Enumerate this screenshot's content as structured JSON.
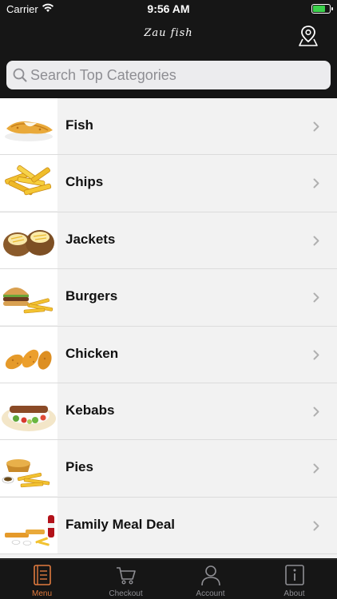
{
  "status_bar": {
    "carrier": "Carrier",
    "time": "9:56 AM"
  },
  "header": {
    "logo_text": "Zau fish"
  },
  "search": {
    "placeholder": "Search Top Categories",
    "value": ""
  },
  "categories": [
    {
      "label": "Fish",
      "icon": "fish-image"
    },
    {
      "label": "Chips",
      "icon": "chips-image"
    },
    {
      "label": "Jackets",
      "icon": "jackets-image"
    },
    {
      "label": "Burgers",
      "icon": "burgers-image"
    },
    {
      "label": "Chicken",
      "icon": "chicken-image"
    },
    {
      "label": "Kebabs",
      "icon": "kebabs-image"
    },
    {
      "label": "Pies",
      "icon": "pies-image"
    },
    {
      "label": "Family Meal Deal",
      "icon": "family-meal-image"
    }
  ],
  "tabs": [
    {
      "label": "Menu",
      "icon": "menu-book-icon",
      "active": true
    },
    {
      "label": "Checkout",
      "icon": "cart-icon",
      "active": false
    },
    {
      "label": "Account",
      "icon": "user-icon",
      "active": false
    },
    {
      "label": "About",
      "icon": "info-icon",
      "active": false
    }
  ],
  "colors": {
    "bar_background": "#161616",
    "accent": "#e07a3e",
    "list_background": "#f2f2f2"
  }
}
